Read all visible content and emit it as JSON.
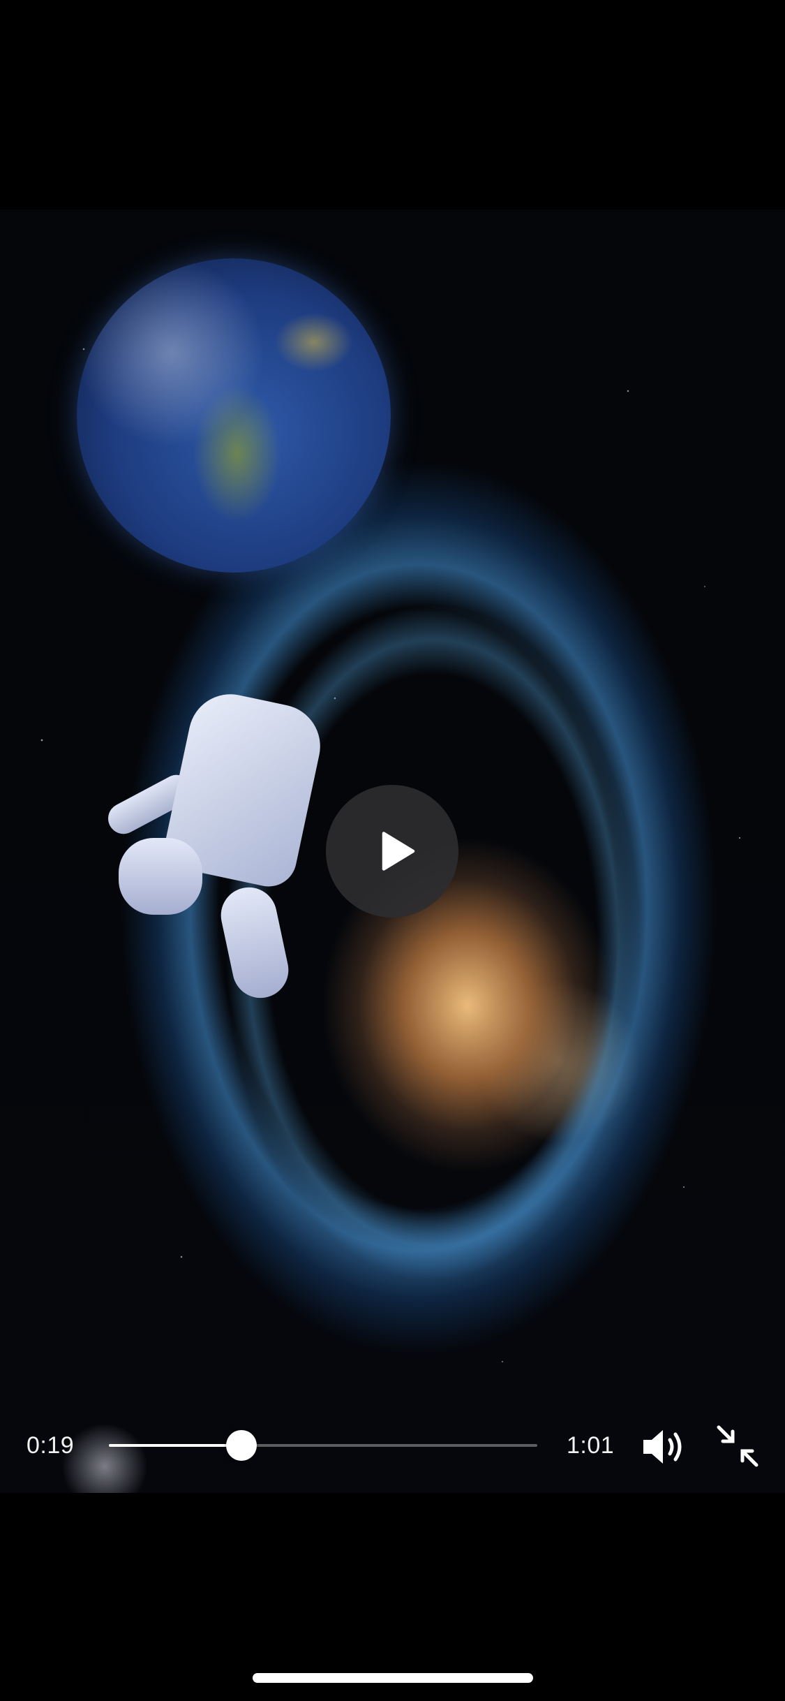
{
  "player": {
    "state": "paused",
    "current_time": "0:19",
    "duration": "1:01",
    "progress_fraction": 0.31
  },
  "icons": {
    "play": "play-icon",
    "volume": "speaker-volume-icon",
    "exit_fullscreen": "exit-fullscreen-icon"
  },
  "colors": {
    "background": "#000000",
    "controls": "#ffffff",
    "play_button_bg": "#2d2d30"
  }
}
